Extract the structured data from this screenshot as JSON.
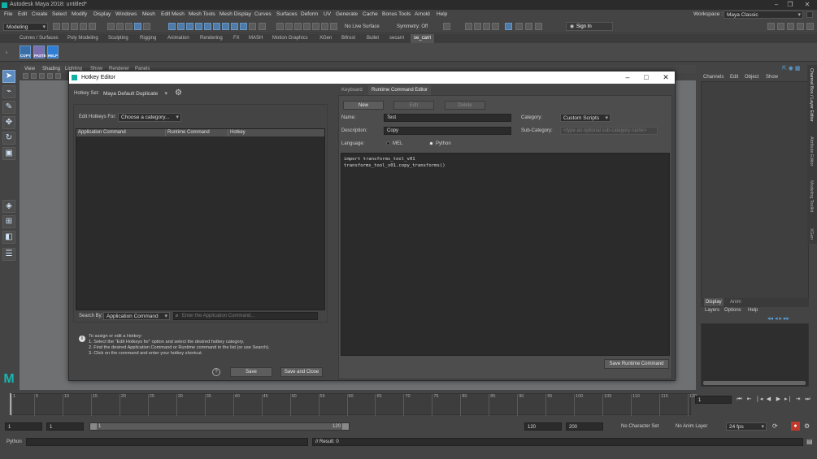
{
  "window": {
    "title": "Autodesk Maya 2018: untitled*"
  },
  "menubar": [
    "File",
    "Edit",
    "Create",
    "Select",
    "Modify",
    "Display",
    "Windows",
    "Mesh",
    "Edit Mesh",
    "Mesh Tools",
    "Mesh Display",
    "Curves",
    "Surfaces",
    "Deform",
    "UV",
    "Generate",
    "Cache",
    "Bonus Tools",
    "Arnold",
    "Help"
  ],
  "workspace": {
    "label": "Workspace :",
    "value": "Maya Classic"
  },
  "statusline": {
    "mode": "Modeling",
    "live_surface": "No Live Surface",
    "symmetry": "Symmetry: Off",
    "sign_in": "Sign In"
  },
  "shelf_tabs": [
    "Curves / Surfaces",
    "Poly Modeling",
    "Sculpting",
    "Rigging",
    "Animation",
    "Rendering",
    "FX",
    "MASH",
    "Motion Graphics",
    "XGen",
    "Bifrost",
    "Bullet",
    "secarri",
    "se_carri"
  ],
  "shelf_tab_active": 13,
  "shelf_buttons": [
    "COPY",
    "PASTE",
    "HELP"
  ],
  "viewport_menu": [
    "View",
    "Shading",
    "Lighting",
    "Show",
    "Renderer",
    "Panels"
  ],
  "right_panel": {
    "tabs": [
      "Channels",
      "Edit",
      "Object",
      "Show"
    ],
    "layer_tabs": [
      "Display",
      "Anim"
    ],
    "layer_menu": [
      "Layers",
      "Options",
      "Help"
    ],
    "side_tabs": [
      "Channel Box / Layer Editor",
      "Attribute Editor",
      "Modeling Toolkit",
      "XGen"
    ]
  },
  "hotkey_editor": {
    "title": "Hotkey Editor",
    "hotkey_set_label": "Hotkey Set:",
    "hotkey_set_value": "Maya Default Duplicate",
    "edit_hotkeys_for_label": "Edit Hotkeys For:",
    "edit_hotkeys_for_value": "Choose a category...",
    "columns": [
      "Application Command",
      "Runtime Command",
      "Hotkey"
    ],
    "search_by_label": "Search By:",
    "search_by_value": "Application Command",
    "search_placeholder": "Enter the Application Command...",
    "info_lines": [
      "To assign or edit a Hotkey:",
      "1. Select the \"Edit Hotkeys for\" option and select the desired hotkey category.",
      "2. Find the desired Application Command or Runtime command in the list (or use Search).",
      "3. Click on the command and enter your hotkey shortcut."
    ],
    "help_glyph": "?",
    "save_label": "Save",
    "save_close_label": "Save and Close",
    "tabs": [
      "Keyboard",
      "Runtime Command Editor"
    ],
    "active_tab": 1,
    "new_label": "New",
    "edit_label": "Edit",
    "delete_label": "Delete",
    "name_label": "Name:",
    "name_value": "Test",
    "description_label": "Description:",
    "description_value": "Copy",
    "category_label": "Category:",
    "category_value": "Custom Scripts",
    "subcategory_label": "Sub-Category:",
    "subcategory_placeholder": "<type an optional sub-category name>",
    "language_label": "Language:",
    "language_options": [
      "MEL",
      "Python"
    ],
    "language_selected": "Python",
    "code_lines": [
      "import transforms_tool_v01",
      "transforms_tool_v01.copy_transforms()"
    ],
    "save_runtime_label": "Save Runtime Command"
  },
  "timeline": {
    "tick_labels": [
      "1",
      "5",
      "10",
      "15",
      "20",
      "25",
      "30",
      "35",
      "40",
      "45",
      "50",
      "55",
      "60",
      "65",
      "70",
      "75",
      "80",
      "85",
      "90",
      "95",
      "100",
      "105",
      "110",
      "115",
      "120"
    ],
    "current_frame": "1"
  },
  "range": {
    "start": "1",
    "start_inner": "1",
    "slider_left": "1",
    "slider_right": "120",
    "end_inner": "120",
    "end": "200",
    "character_set": "No Character Set",
    "anim_layer": "No Anim Layer",
    "fps": "24 fps"
  },
  "command_line": {
    "language": "Python",
    "result": "// Result: 0"
  }
}
